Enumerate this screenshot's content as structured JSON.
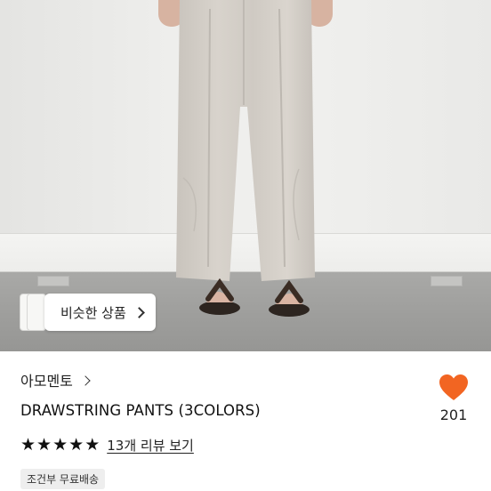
{
  "photo": {
    "similar_button": {
      "label": "비슷한 상품",
      "icon": "chevron-right-icon"
    }
  },
  "product": {
    "brand": "아모멘토",
    "title": "DRAWSTRING PANTS (3COLORS)",
    "rating": {
      "stars": 5,
      "review_text": "13개 리뷰 보기"
    },
    "shipping_badge": "조건부 무료배송",
    "like": {
      "count": "201",
      "color": "#f26522",
      "icon": "heart-icon"
    }
  }
}
